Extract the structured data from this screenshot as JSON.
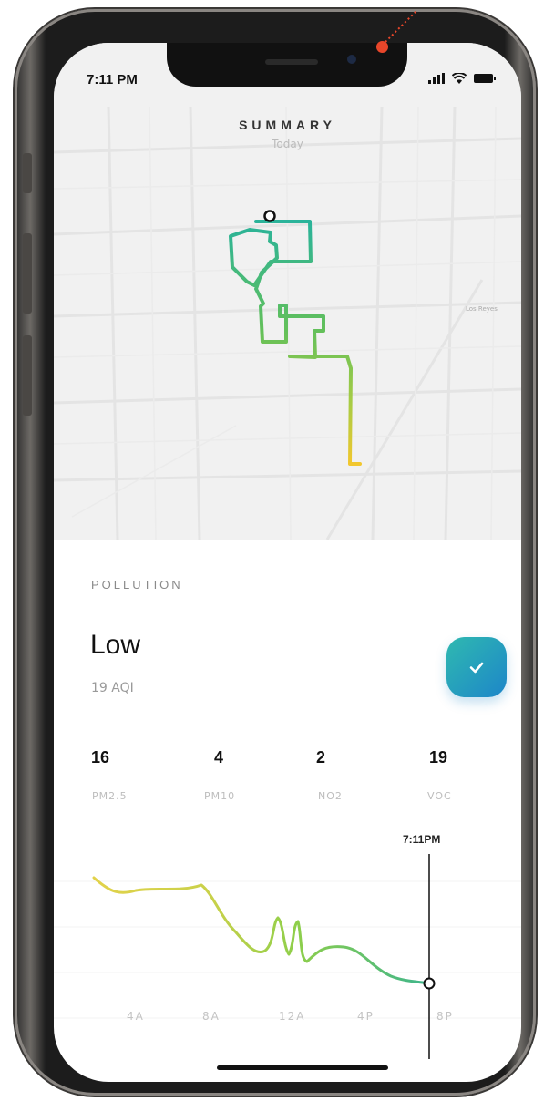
{
  "status_bar": {
    "time": "7:11 PM"
  },
  "header": {
    "title": "SUMMARY",
    "subtitle": "Today"
  },
  "map": {
    "place_label": "Los Reyes"
  },
  "pollution": {
    "section_label": "POLLUTION",
    "level": "Low",
    "aqi": "19 AQI",
    "status_icon": "check-icon",
    "accent_colors": [
      "#2fb9b0",
      "#1d86c9"
    ],
    "metrics": [
      {
        "value": "16",
        "label": "PM2.5"
      },
      {
        "value": "4",
        "label": "PM10"
      },
      {
        "value": "2",
        "label": "NO2"
      },
      {
        "value": "19",
        "label": "VOC"
      }
    ]
  },
  "timeline": {
    "marker_label": "7:11PM",
    "axis_labels": [
      "4A",
      "8A",
      "12A",
      "4P",
      "8P"
    ],
    "gradient_colors": [
      "#e2d24a",
      "#8fcf4a",
      "#3db58c"
    ]
  }
}
